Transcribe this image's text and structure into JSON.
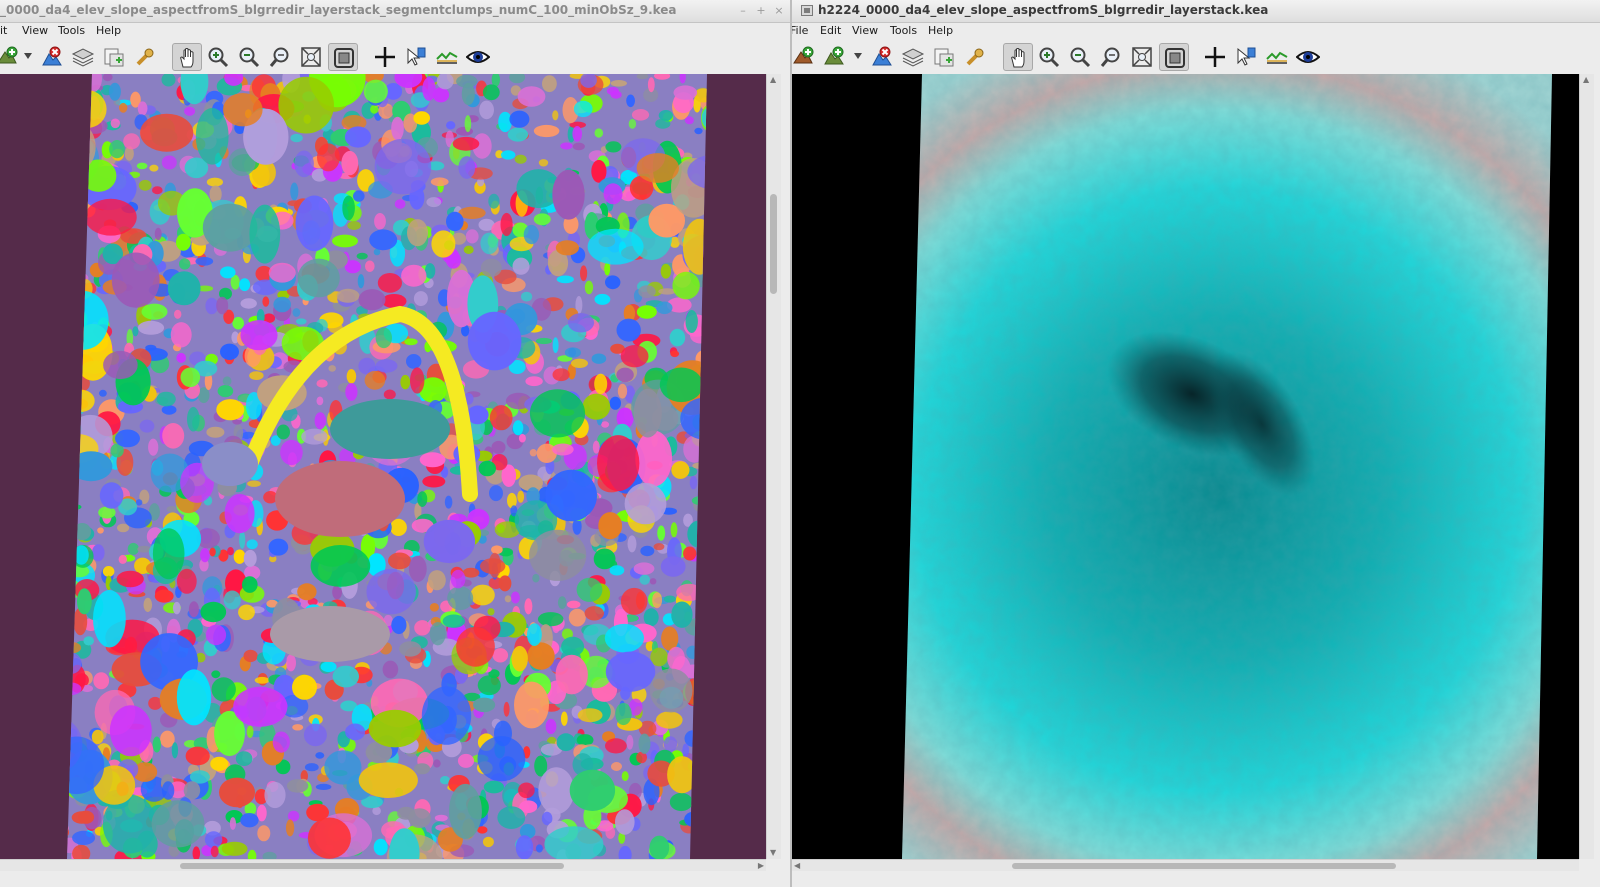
{
  "left_window": {
    "title": "_0000_da4_elev_slope_aspectfromS_blgrredir_layerstack_segmentclumps_numC_100_minObSz_9.kea",
    "controls": {
      "minimize": "–",
      "maximize": "+",
      "close": "×"
    },
    "menu": [
      "it",
      "View",
      "Tools",
      "Help"
    ],
    "toolbar_icons": [
      "add-layer-icon",
      "dropdown-arrow-icon",
      "remove-layer-icon",
      "layers-icon",
      "new-window-icon",
      "query-icon",
      "pan-icon",
      "zoom-in-icon",
      "zoom-out-icon",
      "zoom-native-icon",
      "zoom-full-extent-icon",
      "follow-extent-icon",
      "crosshair-icon",
      "query-point-icon",
      "profile-icon",
      "flicker-icon"
    ],
    "active_tools": [
      "pan-icon",
      "follow-extent-icon"
    ],
    "image": {
      "kind": "segmentation",
      "background": "#552b4a"
    },
    "scroll": {
      "vertical_position": 0.12,
      "horizontal_position": 0.25
    }
  },
  "right_window": {
    "title": "h2224_0000_da4_elev_slope_aspectfromS_blgrredir_layerstack.kea",
    "menu": [
      "File",
      "Edit",
      "View",
      "Tools",
      "Help"
    ],
    "toolbar_icons": [
      "add-layer-icon",
      "add-vector-icon",
      "dropdown-arrow-icon",
      "remove-layer-icon",
      "layers-icon",
      "new-window-icon",
      "query-icon",
      "pan-icon",
      "zoom-in-icon",
      "zoom-out-icon",
      "zoom-native-icon",
      "zoom-full-extent-icon",
      "follow-extent-icon",
      "crosshair-icon",
      "query-point-icon",
      "profile-icon",
      "flicker-icon"
    ],
    "active_tools": [
      "pan-icon",
      "follow-extent-icon"
    ],
    "image": {
      "kind": "false-color",
      "background": "#000000",
      "palette": [
        "#1fd3d7",
        "#0a7f86",
        "#9ad9d8",
        "#d48b8b"
      ]
    },
    "scroll": {
      "vertical_position": 0.0,
      "horizontal_position": 0.4
    }
  },
  "colors": {
    "chrome": "#ececec",
    "titlebar": "#dedede",
    "active_tool": "#d4d4d4"
  }
}
